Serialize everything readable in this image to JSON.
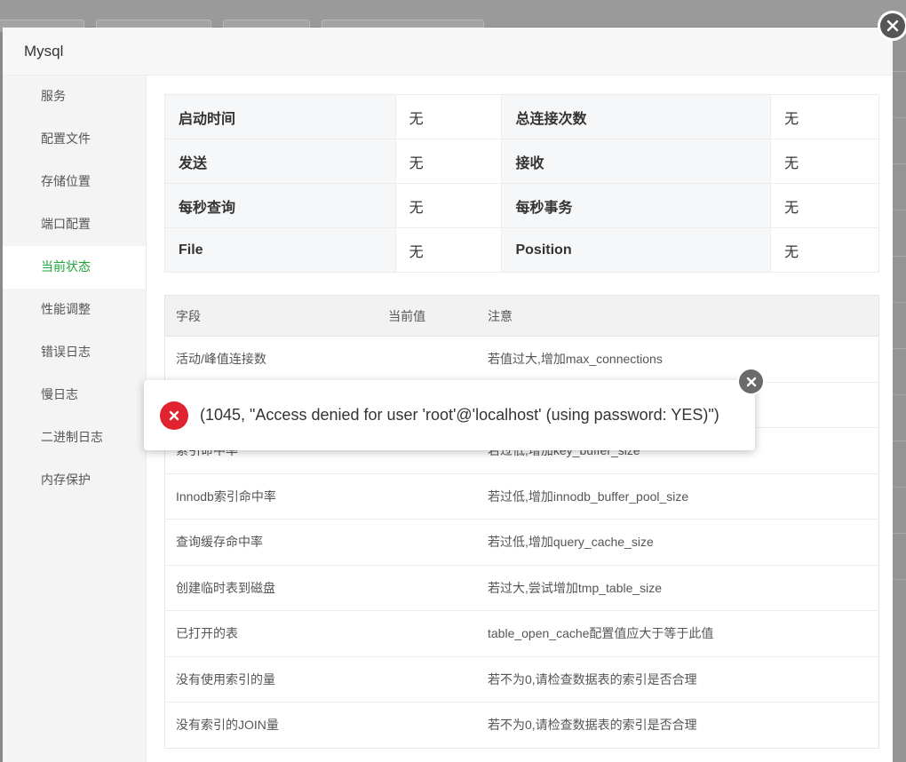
{
  "window": {
    "title": "Mysql"
  },
  "sidebar": {
    "items": [
      {
        "label": "服务"
      },
      {
        "label": "配置文件"
      },
      {
        "label": "存储位置"
      },
      {
        "label": "端口配置"
      },
      {
        "label": "当前状态",
        "active": true
      },
      {
        "label": "性能调整"
      },
      {
        "label": "错误日志"
      },
      {
        "label": "慢日志"
      },
      {
        "label": "二进制日志"
      },
      {
        "label": "内存保护"
      }
    ]
  },
  "summary": {
    "rows": [
      [
        "启动时间",
        "无",
        "总连接次数",
        "无"
      ],
      [
        "发送",
        "无",
        "接收",
        "无"
      ],
      [
        "每秒查询",
        "无",
        "每秒事务",
        "无"
      ],
      [
        "File",
        "无",
        "Position",
        "无"
      ]
    ]
  },
  "status_table": {
    "headers": [
      "字段",
      "当前值",
      "注意"
    ],
    "rows": [
      [
        "活动/峰值连接数",
        "",
        "若值过大,增加max_connections"
      ],
      [
        "",
        "",
        ""
      ],
      [
        "索引命中率",
        "",
        "若过低,增加key_buffer_size"
      ],
      [
        "Innodb索引命中率",
        "",
        "若过低,增加innodb_buffer_pool_size"
      ],
      [
        "查询缓存命中率",
        "",
        "若过低,增加query_cache_size"
      ],
      [
        "创建临时表到磁盘",
        "",
        "若过大,尝试增加tmp_table_size"
      ],
      [
        "已打开的表",
        "",
        "table_open_cache配置值应大于等于此值"
      ],
      [
        "没有使用索引的量",
        "",
        "若不为0,请检查数据表的索引是否合理"
      ],
      [
        "没有索引的JOIN量",
        "",
        "若不为0,请检查数据表的索引是否合理"
      ]
    ]
  },
  "toast": {
    "message": "(1045, \"Access denied for user 'root'@'localhost' (using password: YES)\")",
    "icon": "error-x-icon",
    "color": "#e0232e"
  },
  "colors": {
    "accent": "#20a53a"
  }
}
